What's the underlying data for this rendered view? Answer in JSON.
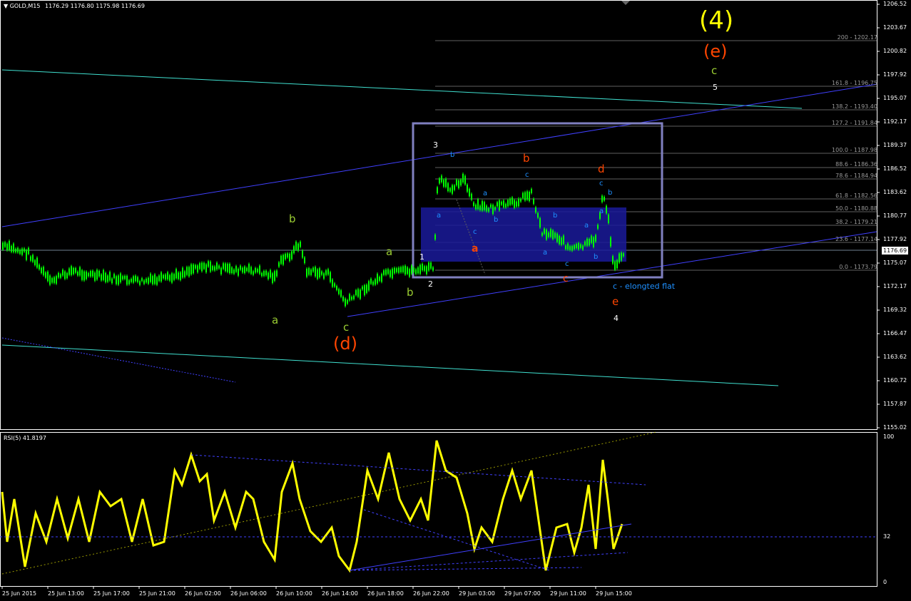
{
  "header": {
    "symbol": "GOLD,M15",
    "ohlc": "1176.29 1176.80 1175.98 1176.69",
    "indicator": "RSI(5) 41.8197"
  },
  "price_axis": [
    "1206.52",
    "1203.67",
    "1200.82",
    "1197.92",
    "1195.07",
    "1192.17",
    "1189.37",
    "1186.52",
    "1183.62",
    "1180.77",
    "1177.92",
    "1175.07",
    "1172.17",
    "1169.32",
    "1166.47",
    "1163.62",
    "1160.72",
    "1157.87",
    "1155.02"
  ],
  "current_price": "1176.69",
  "rsi_axis": [
    "100",
    "32",
    "0"
  ],
  "time_axis": [
    "25 Jun 2015",
    "25 Jun 13:00",
    "25 Jun 17:00",
    "25 Jun 21:00",
    "26 Jun 02:00",
    "26 Jun 06:00",
    "26 Jun 10:00",
    "26 Jun 14:00",
    "26 Jun 18:00",
    "26 Jun 22:00",
    "29 Jun 03:00",
    "29 Jun 07:00",
    "29 Jun 11:00",
    "29 Jun 15:00"
  ],
  "fib_levels": [
    "200 - 1202.17",
    "161.8 - 1196.75",
    "138.2 - 1193.40",
    "127.2 - 1191.84",
    "100.0 - 1187.98",
    "88.6 - 1186.36",
    "78.6 - 1184.94",
    "61.8 - 1182.56",
    "50.0 - 1180.88",
    "38.2 - 1179.21",
    "23.6 - 1177.14",
    "0.0 - 1173.79"
  ],
  "wave_labels": {
    "big4": "(4)",
    "big_e": "(e)",
    "top_c": "c",
    "top_5": "5",
    "d_paren": "(d)",
    "c_low": "c",
    "a_left": "a",
    "b_left": "b",
    "a_mid": "a",
    "b_mid": "b",
    "w1": "1",
    "w2": "2",
    "w3": "3",
    "red_a": "a",
    "red_b": "b",
    "red_d": "d",
    "red_c": "c",
    "red_e": "e",
    "w4": "4",
    "blue_a1": "a",
    "blue_b1": "b",
    "blue_c1": "c",
    "blue_a2": "a",
    "blue_b2": "b",
    "blue_c2": "c",
    "blue_a3": "a",
    "blue_b3": "b",
    "blue_c3": "c",
    "blue_a4": "a",
    "blue_b4": "b",
    "blue_c4": "c",
    "blue_a5": "a",
    "blue_b5": "b",
    "elongated": "c - elongted flat"
  },
  "colors": {
    "background": "#000000",
    "candles": "#00ff00",
    "rsi": "#ffff00",
    "trend": "#4040ff",
    "channel": "#40e0d0",
    "orange": "#ff4500",
    "yellow_green": "#9acd32",
    "label_blue": "#1e90ff",
    "box": "#8080c0"
  }
}
